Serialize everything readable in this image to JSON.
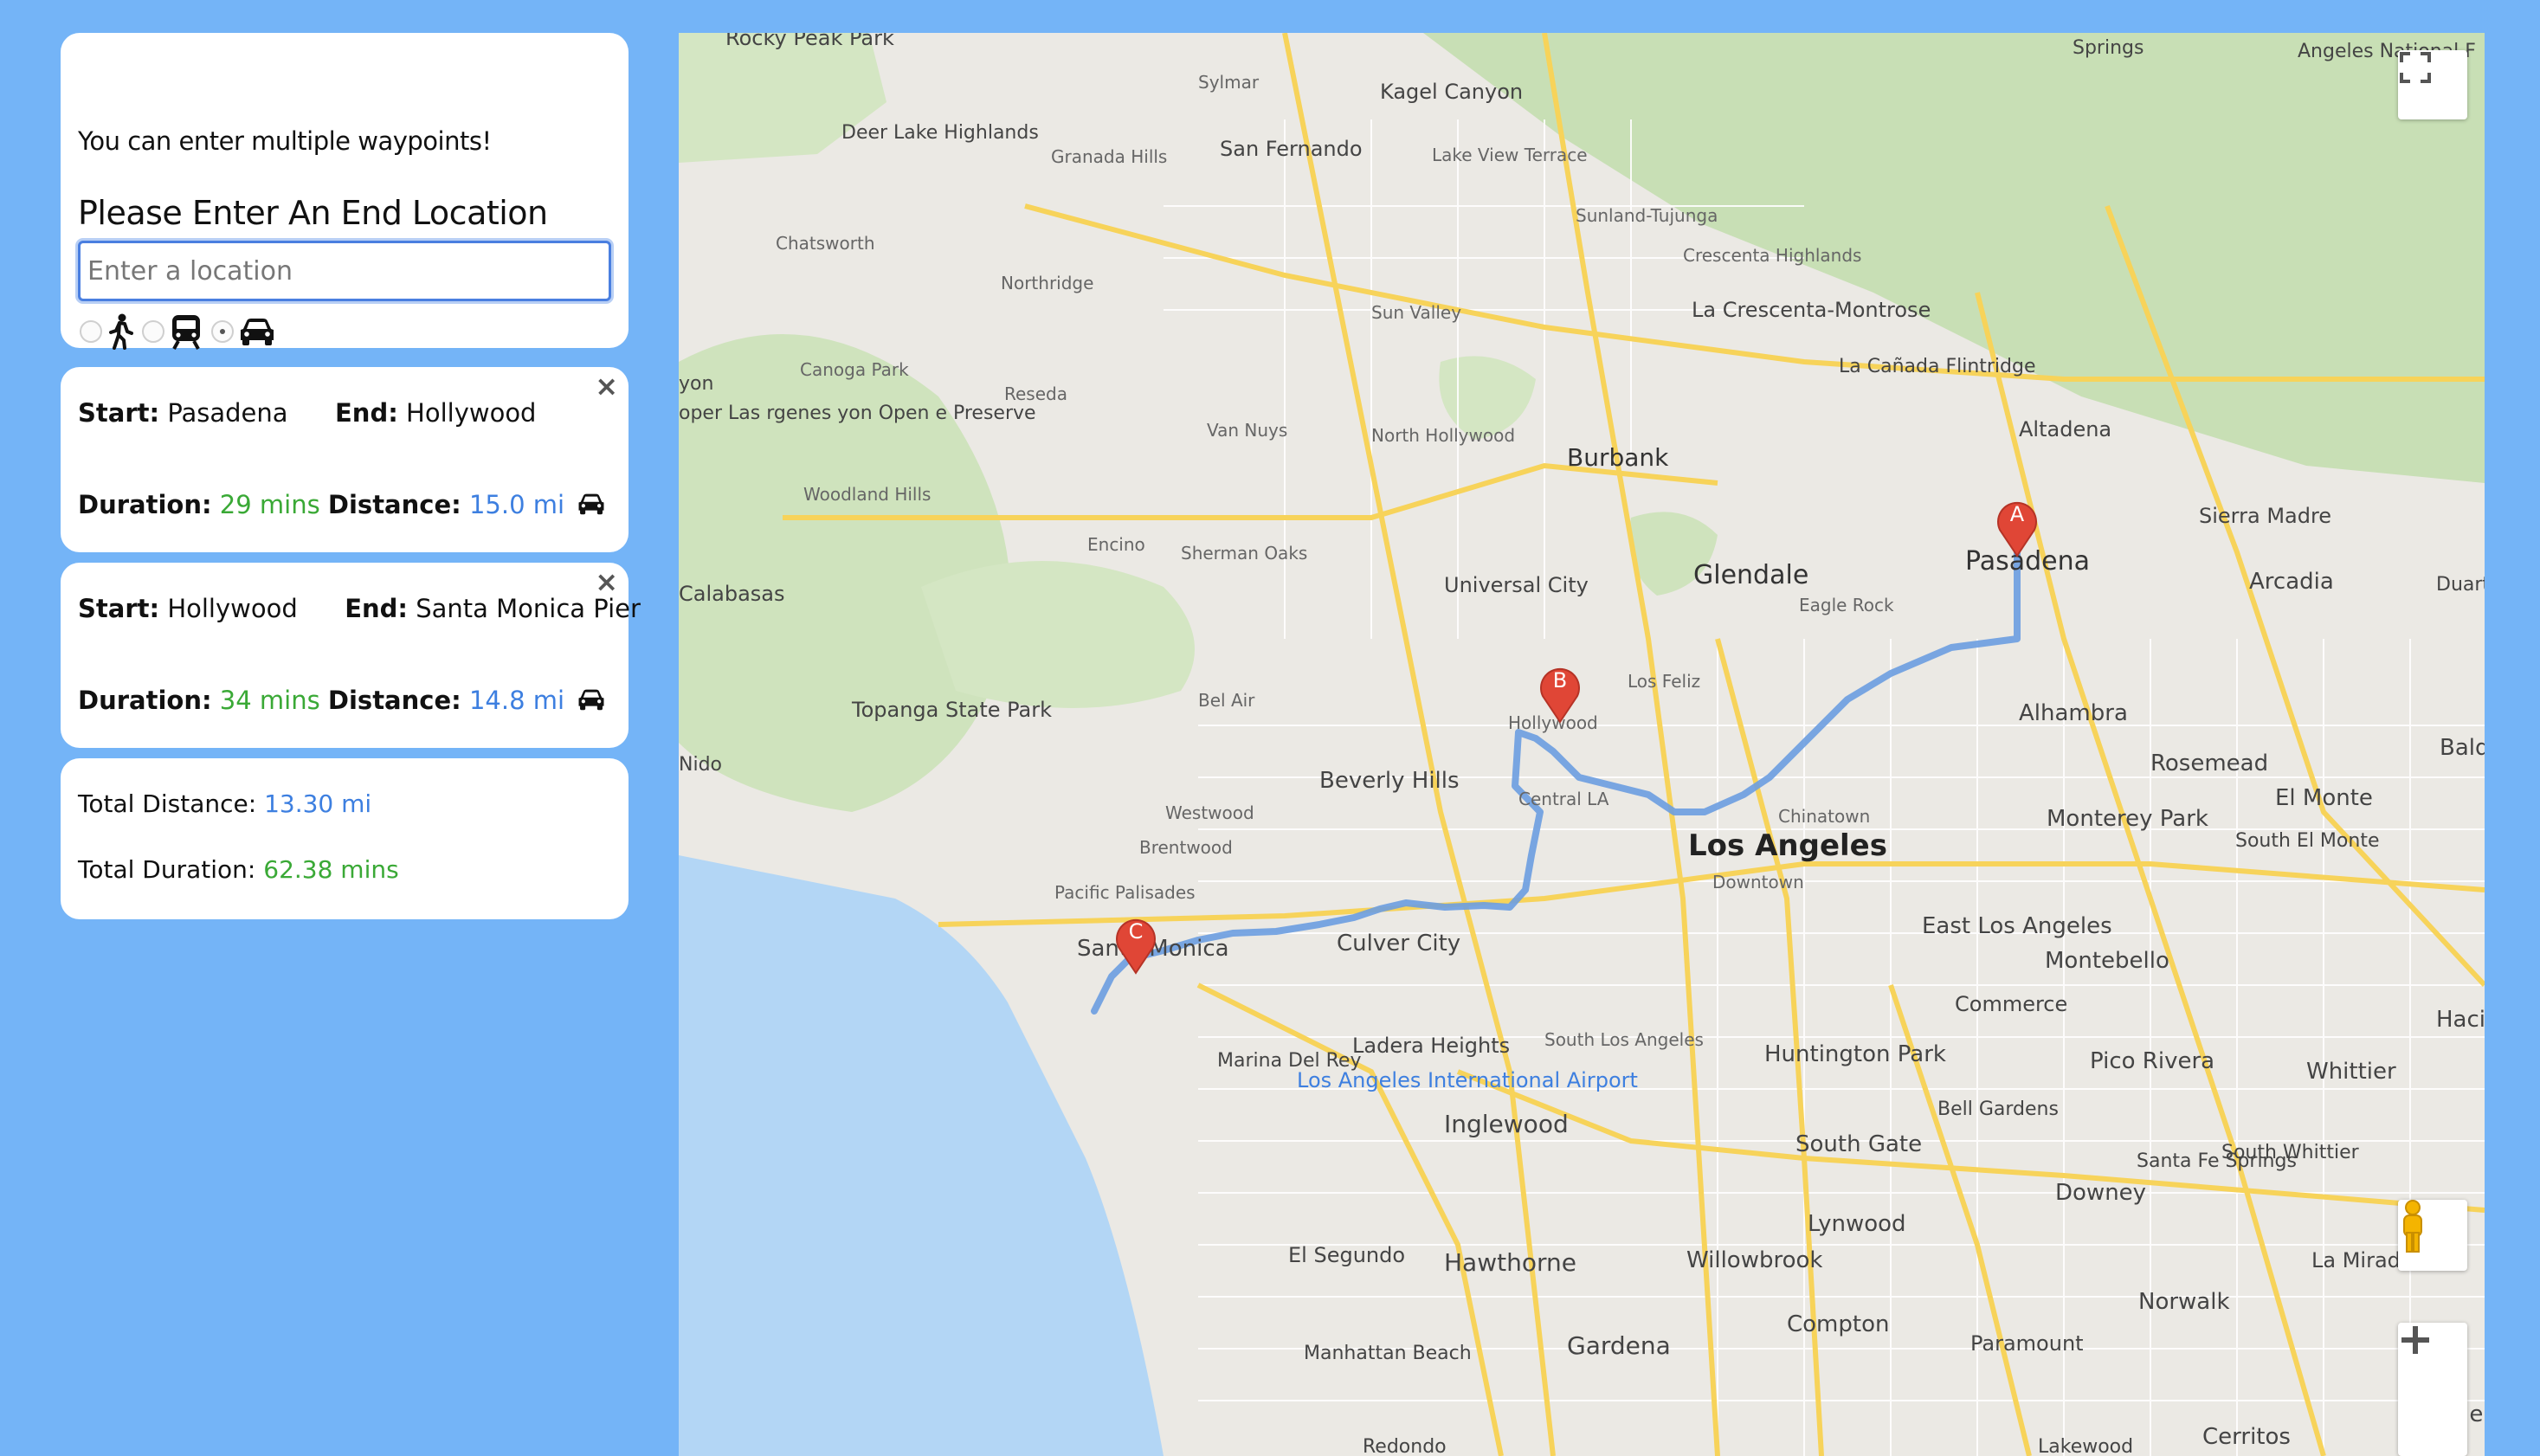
{
  "search": {
    "hint": "You can enter multiple waypoints!",
    "heading": "Please Enter An End Location",
    "placeholder": "Enter a location",
    "modes": [
      "walk-icon",
      "transit-icon",
      "car-icon"
    ],
    "selected_mode": "car"
  },
  "legs": [
    {
      "start_label": "Start:",
      "start": "Pasadena",
      "end_label": "End:",
      "end": "Hollywood",
      "duration_label": "Duration:",
      "duration": "29 mins",
      "distance_label": "Distance:",
      "distance": "15.0 mi",
      "close": "×"
    },
    {
      "start_label": "Start:",
      "start": "Hollywood",
      "end_label": "End:",
      "end": "Santa Monica Pier",
      "duration_label": "Duration:",
      "duration": "34 mins",
      "distance_label": "Distance:",
      "distance": "14.8 mi",
      "close": "×"
    }
  ],
  "totals": {
    "distance_label": "Total Distance:",
    "distance": "13.30 mi",
    "duration_label": "Total Duration:",
    "duration": "62.38 mins"
  },
  "map": {
    "markers": [
      {
        "letter": "A",
        "place": "Pasadena"
      },
      {
        "letter": "B",
        "place": "Hollywood"
      },
      {
        "letter": "C",
        "place": "Santa Monica"
      }
    ],
    "places": [
      "Rocky Peak Park",
      "Sylmar",
      "Kagel Canyon",
      "Deer Lake Highlands",
      "Granada Hills",
      "San Fernando",
      "Lake View Terrace",
      "Sunland-Tujunga",
      "Chatsworth",
      "Northridge",
      "Sun Valley",
      "Crescenta Highlands",
      "La Crescenta-Montrose",
      "Canoga Park",
      "Reseda",
      "Van Nuys",
      "North Hollywood",
      "La Cañada Flintridge",
      "Altadena",
      "Burbank",
      "Woodland Hills",
      "Encino",
      "Sherman Oaks",
      "Universal City",
      "Glendale",
      "Eagle Rock",
      "Pasadena",
      "Sierra Madre",
      "Arcadia",
      "Duarte",
      "Calabasas",
      "Los Feliz",
      "Hollywood",
      "Bel Air",
      "Topanga State Park",
      "Alhambra",
      "Rosemead",
      "Baldw",
      "Beverly Hills",
      "Central LA",
      "Chinatown",
      "El Monte",
      "Westwood",
      "Brentwood",
      "Los Angeles",
      "Monterey Park",
      "South El Monte",
      "Downtown",
      "Pacific Palisades",
      "Santa Monica",
      "Culver City",
      "East Los Angeles",
      "Montebello",
      "Commerce",
      "Marina Del Rey",
      "Ladera Heights",
      "South Los Angeles",
      "Huntington Park",
      "Pico Rivera",
      "Whittier",
      "Los Angeles International Airport",
      "Inglewood",
      "Bell Gardens",
      "South Gate",
      "Santa Fe Springs",
      "South Whittier",
      "Downey",
      "El Segundo",
      "Hawthorne",
      "Lynwood",
      "Willowbrook",
      "La Mirad",
      "Norwalk",
      "Manhattan Beach",
      "Gardena",
      "Compton",
      "Paramount",
      "Cerritos",
      "Buena",
      "Hacien Heigh",
      "Springs",
      "Angeles National F",
      "Redondo",
      "Lakewood",
      "Nido",
      "yon",
      "oper Las rgenes yon Open e Preserve"
    ],
    "colors": {
      "land": "#ebe9e4",
      "water": "#b3d6f5",
      "park": "#c8dfb5",
      "highway": "#f7d35a",
      "route": "#6b9de0",
      "marker": "#e04636"
    }
  }
}
